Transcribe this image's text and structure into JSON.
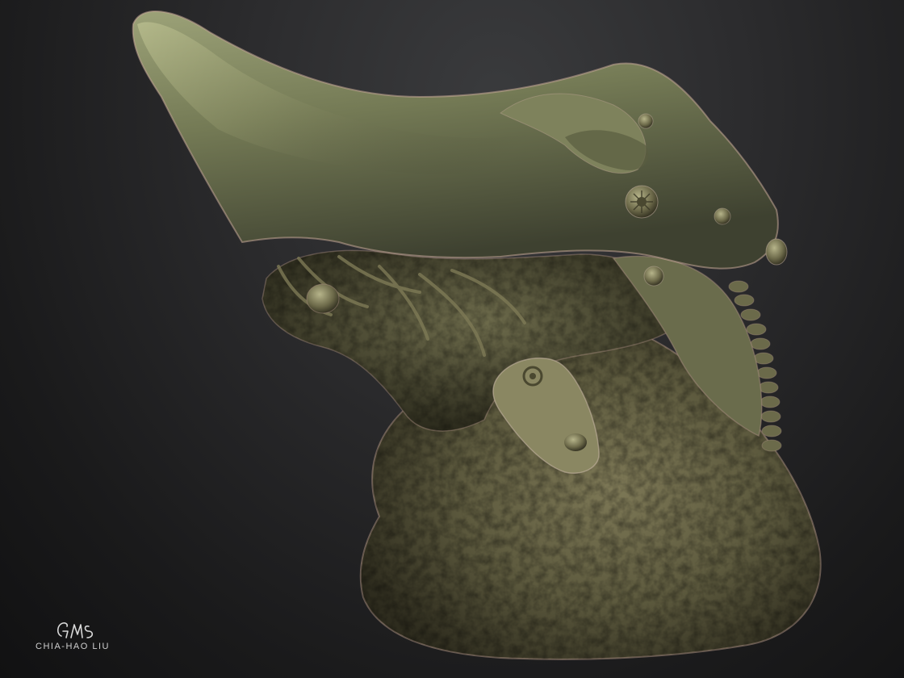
{
  "artwork": {
    "subject": "",
    "credit": "CHIA-HAO LIU",
    "monogram": "GMs",
    "colors": {
      "background_light": "#3a3b3d",
      "background_dark": "#111112",
      "helmet_light": "#8e9468",
      "helmet_mid": "#6c7050",
      "helmet_dark": "#3c3e2a",
      "skin_light": "#7e7a58",
      "skin_mid": "#5e5a3e",
      "skin_dark": "#2f2c1e",
      "rim": "#b89a8a"
    }
  }
}
